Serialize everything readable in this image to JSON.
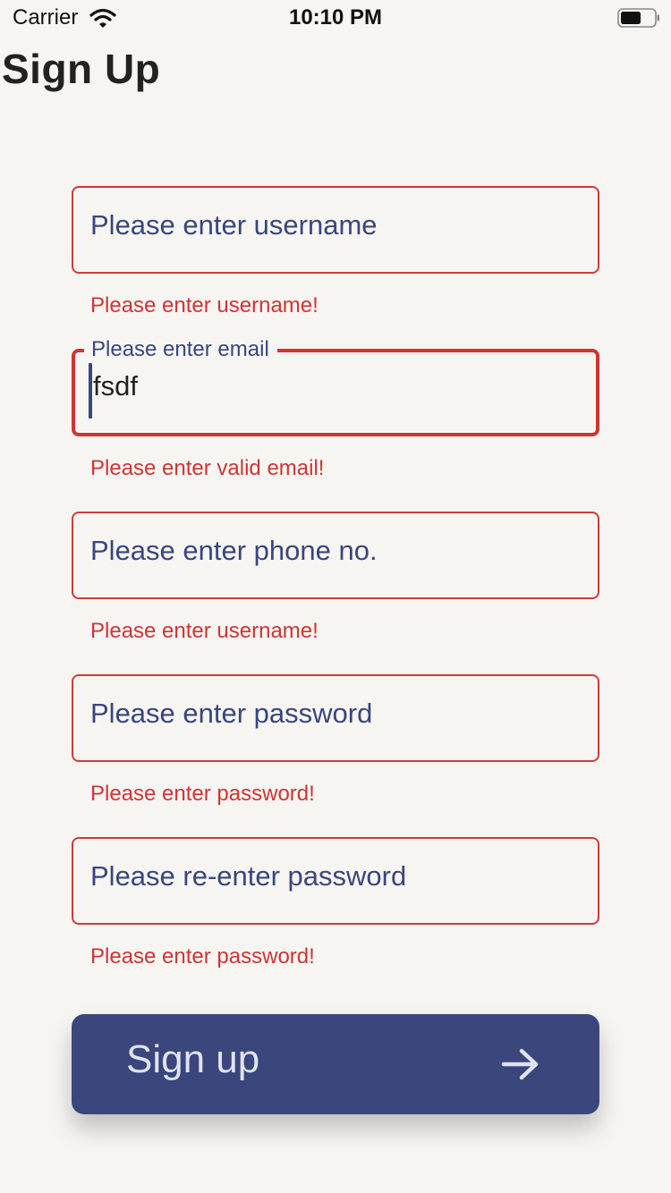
{
  "status_bar": {
    "carrier": "Carrier",
    "time": "10:10 PM"
  },
  "page": {
    "title": "Sign Up"
  },
  "form": {
    "username": {
      "placeholder": "Please enter username",
      "error": "Please enter username!"
    },
    "email": {
      "label": "Please enter email",
      "value": "fsdf",
      "error": "Please enter valid email!"
    },
    "phone": {
      "placeholder": "Please enter phone no.",
      "error": "Please enter username!"
    },
    "password": {
      "placeholder": "Please enter password",
      "error": "Please enter password!"
    },
    "confirm_password": {
      "placeholder": "Please re-enter password",
      "error": "Please enter password!"
    }
  },
  "signup_button": {
    "label": "Sign up",
    "icon": "arrow-right-icon"
  },
  "colors": {
    "background": "#f7f5f2",
    "accent": "#3a467c",
    "error": "#d03434",
    "button_text": "#dfe3f3"
  }
}
